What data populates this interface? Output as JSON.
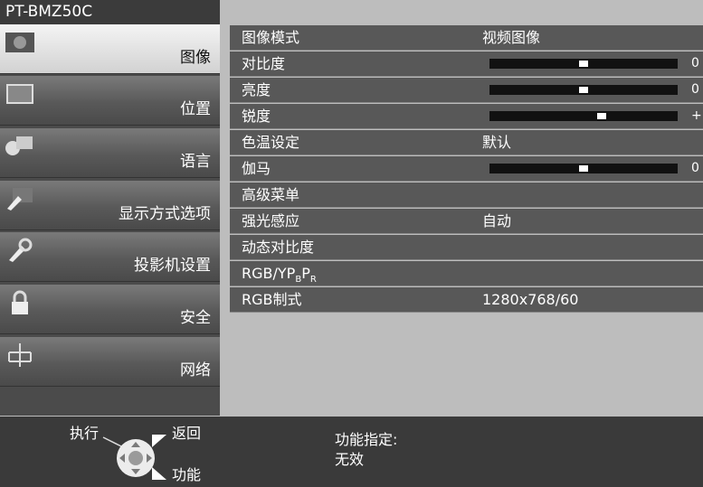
{
  "title": "PT-BMZ50C",
  "sidebar": {
    "items": [
      {
        "label": "图像",
        "icon": "picture-icon"
      },
      {
        "label": "位置",
        "icon": "position-icon"
      },
      {
        "label": "语言",
        "icon": "language-icon"
      },
      {
        "label": "显示方式选项",
        "icon": "display-option-icon"
      },
      {
        "label": "投影机设置",
        "icon": "wrench-icon"
      },
      {
        "label": "安全",
        "icon": "lock-icon"
      },
      {
        "label": "网络",
        "icon": "network-icon"
      }
    ],
    "selected_index": 0
  },
  "menu": {
    "rows": [
      {
        "label": "图像模式",
        "value": "视频图像"
      },
      {
        "label": "对比度",
        "slider_level": 0.5,
        "end_mark": "0"
      },
      {
        "label": "亮度",
        "slider_level": 0.5,
        "end_mark": "0"
      },
      {
        "label": "锐度",
        "slider_level": 0.6,
        "end_mark": "+"
      },
      {
        "label": "色温设定",
        "value": "默认"
      },
      {
        "label": "伽马",
        "slider_level": 0.5,
        "end_mark": "0"
      },
      {
        "label": "高级菜单"
      },
      {
        "label": "强光感应",
        "value": "自动"
      },
      {
        "label": "动态对比度"
      },
      {
        "label": "RGB/YP",
        "sub1": "B",
        "p2": "P",
        "sub2": "R"
      },
      {
        "label": "RGB制式",
        "value": "1280x768/60"
      }
    ]
  },
  "bottom": {
    "execute": "执行",
    "back": "返回",
    "function": "功能",
    "func_assign_label": "功能指定:",
    "func_assign_value": "无效"
  },
  "colors": {
    "selected_bg": "#e6e6e6",
    "row_bg": "#585858",
    "bg": "#bdbdbd"
  }
}
